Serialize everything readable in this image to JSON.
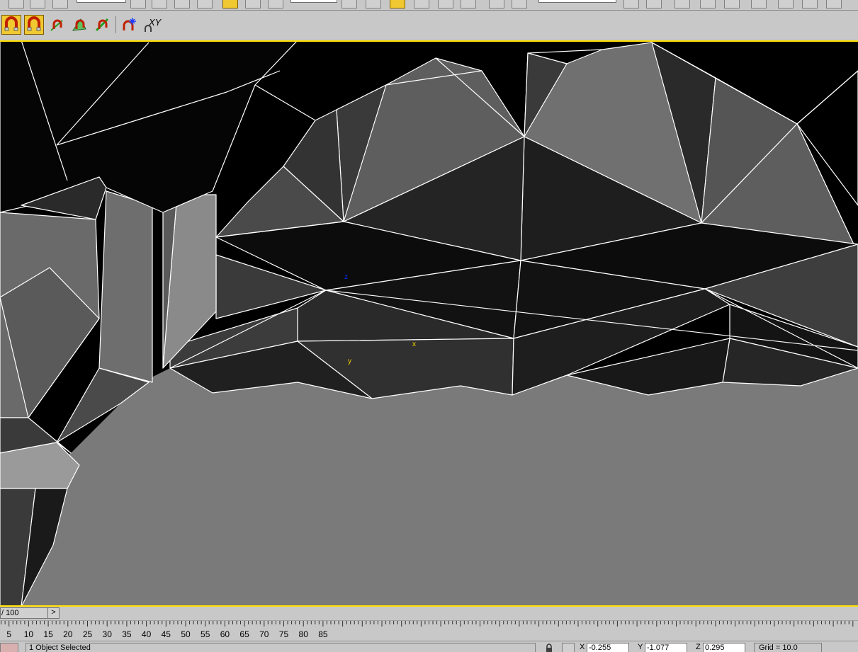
{
  "toolbar": {
    "snap_mode_buttons": [
      "snap-toggle",
      "angle-snap",
      "percent-snap",
      "spinner-snap",
      "edit-named-selection",
      "keyboard-shortcut-override"
    ],
    "xy_label": "XY",
    "accent": "#f0c830"
  },
  "viewport": {
    "active_border_color": "#ffe000",
    "gizmo": {
      "x_label": "x",
      "y_label": "y",
      "z_label": "z",
      "x_color": "#ffd000",
      "y_color": "#ffd000",
      "z_color": "#0030ff"
    }
  },
  "timeslider": {
    "value": "/ 100",
    "next_label": ">"
  },
  "trackbar": {
    "ticks": [
      "5",
      "10",
      "15",
      "20",
      "25",
      "30",
      "35",
      "40",
      "45",
      "50",
      "55",
      "60",
      "65",
      "70",
      "75",
      "80",
      "85"
    ]
  },
  "statusbar": {
    "prompt": "1 Object Selected",
    "x_label": "X",
    "x_value": "-0.255",
    "y_label": "Y",
    "y_value": "-1.077",
    "z_label": "Z",
    "z_value": "0.295",
    "grid": "Grid = 10.0"
  }
}
